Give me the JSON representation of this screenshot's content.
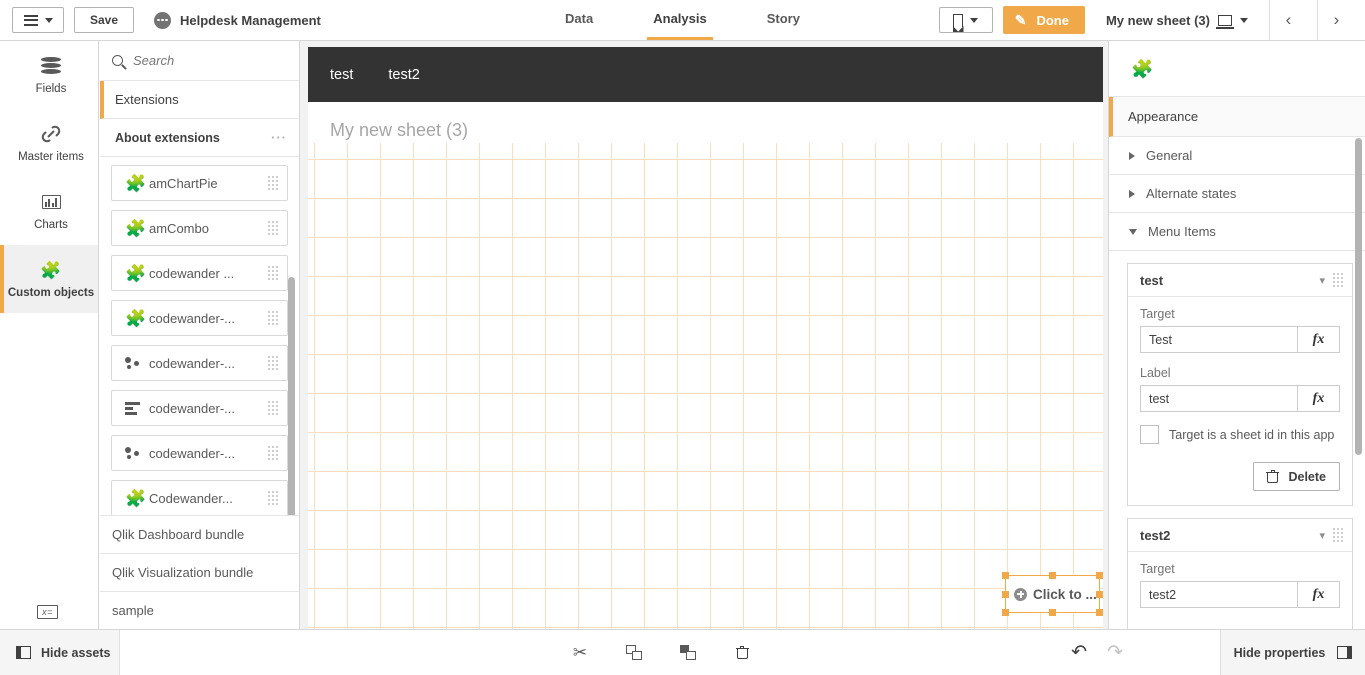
{
  "topbar": {
    "menu_label": "",
    "save_label": "Save",
    "app_title": "Helpdesk Management",
    "nav_tabs": [
      {
        "label": "Data",
        "active": false
      },
      {
        "label": "Analysis",
        "active": true
      },
      {
        "label": "Story",
        "active": false
      }
    ],
    "bookmark_label": "",
    "done_label": "Done",
    "sheet_name": "My new sheet (3)",
    "prev_label": "‹",
    "next_label": "›"
  },
  "rail": {
    "items": [
      {
        "label": "Fields",
        "icon": "database-icon",
        "active": false
      },
      {
        "label": "Master items",
        "icon": "link-icon",
        "active": false
      },
      {
        "label": "Charts",
        "icon": "bar-chart-icon",
        "active": false
      },
      {
        "label": "Custom objects",
        "icon": "puzzle-icon",
        "active": true
      }
    ],
    "variables_icon": "x="
  },
  "assets": {
    "search_placeholder": "Search",
    "search_value": "",
    "section_tab": "Extensions",
    "group_header": "About extensions",
    "group_menu": "···",
    "extensions": [
      {
        "name": "amChartPie",
        "icon": "puzzle-icon"
      },
      {
        "name": "amCombo",
        "icon": "puzzle-icon"
      },
      {
        "name": "codewander ...",
        "icon": "puzzle-icon"
      },
      {
        "name": "codewander-...",
        "icon": "puzzle-icon"
      },
      {
        "name": "codewander-...",
        "icon": "scatter-icon"
      },
      {
        "name": "codewander-...",
        "icon": "horizontal-bar-icon"
      },
      {
        "name": "codewander-...",
        "icon": "scatter-icon"
      },
      {
        "name": "Codewander...",
        "icon": "puzzle-icon"
      }
    ],
    "bundles": [
      "Qlik Dashboard bundle",
      "Qlik Visualization bundle",
      "sample"
    ]
  },
  "sheet": {
    "extension_menu": [
      "test",
      "test2"
    ],
    "title": "My new sheet (3)",
    "selected_object_label": "Click to ..."
  },
  "properties": {
    "header_icon": "puzzle-icon",
    "tab": "Appearance",
    "accordions": [
      {
        "label": "General",
        "expanded": false
      },
      {
        "label": "Alternate states",
        "expanded": false
      },
      {
        "label": "Menu Items",
        "expanded": true
      }
    ],
    "menu_items": [
      {
        "title": "test",
        "target_label": "Target",
        "target_value": "Test",
        "label_label": "Label",
        "label_value": "test",
        "checkbox_label": "Target is a sheet id in this app",
        "checkbox_checked": false,
        "delete_label": "Delete",
        "fx_label": "fx"
      },
      {
        "title": "test2",
        "target_label": "Target",
        "target_value": "test2",
        "fx_label": "fx"
      }
    ]
  },
  "bottombar": {
    "hide_assets": "Hide assets",
    "hide_properties": "Hide properties",
    "tools": [
      {
        "name": "cut-icon"
      },
      {
        "name": "copy-icon"
      },
      {
        "name": "paste-icon"
      },
      {
        "name": "delete-icon"
      }
    ],
    "undo": "↶",
    "redo": "↷"
  },
  "colors": {
    "accent": "#f0a848",
    "grid_line": "#fbddc0",
    "dark_bar": "#333333"
  }
}
